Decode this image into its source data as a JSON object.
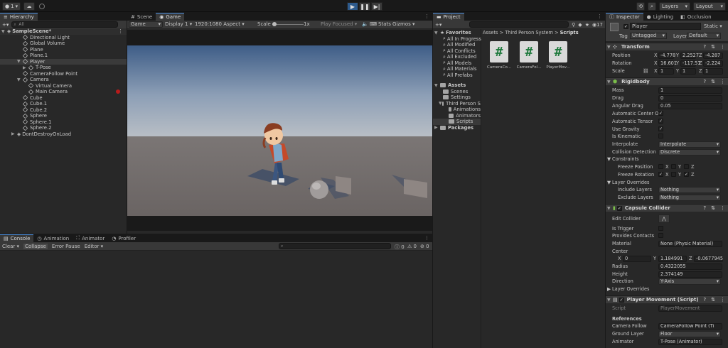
{
  "toolbar": {
    "account": "1",
    "layers": "Layers",
    "layout": "Layout"
  },
  "hierarchy": {
    "tab": "Hierarchy",
    "search_placeholder": "All",
    "scene": "SampleScene*",
    "items": [
      {
        "label": "Directional Light"
      },
      {
        "label": "Global Volume"
      },
      {
        "label": "Plane"
      },
      {
        "label": "Plane.1"
      },
      {
        "label": "Player"
      },
      {
        "label": "T-Pose"
      },
      {
        "label": "CameraFollow Point"
      },
      {
        "label": "Camera"
      },
      {
        "label": "Virtual Camera"
      },
      {
        "label": "Main Camera"
      },
      {
        "label": "Cube"
      },
      {
        "label": "Cube.1"
      },
      {
        "label": "Cube.2"
      },
      {
        "label": "Sphere"
      },
      {
        "label": "Sphere.1"
      },
      {
        "label": "Sphere.2"
      }
    ],
    "dontdestroy": "DontDestroyOnLoad"
  },
  "game": {
    "tabs": [
      "Scene",
      "Game"
    ],
    "mode": "Game",
    "display": "Display 1",
    "aspect": "1920:1080 Aspect",
    "scale_label": "Scale",
    "scale_value": "1x",
    "play_focused": "Play Focused",
    "stats": "Stats",
    "gizmos": "Gizmos"
  },
  "console": {
    "tabs": [
      "Console",
      "Animation",
      "Animator",
      "Profiler"
    ],
    "clear": "Clear",
    "collapse": "Collapse",
    "error_pause": "Error Pause",
    "editor": "Editor",
    "counts": [
      "0",
      "0",
      "0"
    ]
  },
  "project": {
    "tab": "Project",
    "breadcrumb": [
      "Assets",
      "Third Person System",
      "Scripts"
    ],
    "favorites_header": "Favorites",
    "favorites": [
      "All In Progress",
      "All Modified",
      "All Conflicts",
      "All Excluded",
      "All Models",
      "All Materials",
      "All Prefabs"
    ],
    "assets_header": "Assets",
    "assets": [
      "Scenes",
      "Settings",
      "Third Person S",
      "Animations",
      "Animators",
      "Scripts"
    ],
    "packages": "Packages",
    "files": [
      "CameraCo...",
      "CameraFol...",
      "PlayerMov..."
    ],
    "hidden_count": "17"
  },
  "inspector": {
    "tabs": [
      "Inspector",
      "Lighting",
      "Occlusion"
    ],
    "object_name": "Player",
    "static": "Static",
    "tag_label": "Tag",
    "tag_value": "Untagged",
    "layer_label": "Layer",
    "layer_value": "Default",
    "transform": {
      "title": "Transform",
      "position_label": "Position",
      "position": [
        "-4.778",
        "2.2527",
        "-4.287"
      ],
      "rotation_label": "Rotation",
      "rotation": [
        "16.601",
        "-117.51",
        "-2.224"
      ],
      "scale_label": "Scale",
      "scale": [
        "1",
        "1",
        "1"
      ]
    },
    "rigidbody": {
      "title": "Rigidbody",
      "mass_label": "Mass",
      "mass": "1",
      "drag_label": "Drag",
      "drag": "0",
      "angular_drag_label": "Angular Drag",
      "angular_drag": "0.05",
      "auto_com_label": "Automatic Center Of",
      "auto_tensor_label": "Automatic Tensor",
      "use_gravity_label": "Use Gravity",
      "is_kinematic_label": "Is Kinematic",
      "interpolate_label": "Interpolate",
      "interpolate": "Interpolate",
      "collision_label": "Collision Detection",
      "collision": "Discrete",
      "constraints_label": "Constraints",
      "freeze_pos_label": "Freeze Position",
      "freeze_rot_label": "Freeze Rotation",
      "layer_overrides_label": "Layer Overrides",
      "include_layers_label": "Include Layers",
      "include_layers": "Nothing",
      "exclude_layers_label": "Exclude Layers",
      "exclude_layers": "Nothing"
    },
    "capsule": {
      "title": "Capsule Collider",
      "edit_collider_label": "Edit Collider",
      "is_trigger_label": "Is Trigger",
      "provides_contacts_label": "Provides Contacts",
      "material_label": "Material",
      "material": "None (Physic Material)",
      "center_label": "Center",
      "center": [
        "0",
        "1.184991",
        "-0.0677945"
      ],
      "radius_label": "Radius",
      "radius": "0.4322055",
      "height_label": "Height",
      "height": "2.374149",
      "direction_label": "Direction",
      "direction": "Y-Axis",
      "layer_overrides_label": "Layer Overrides"
    },
    "player_movement": {
      "title": "Player Movement (Script)",
      "script_label": "Script",
      "script": "PlayerMovement",
      "references_label": "References",
      "camera_follow_label": "Camera Follow",
      "camera_follow": "CameraFollow Point (Ti",
      "ground_layer_label": "Ground Layer",
      "ground_layer": "Floor",
      "animator_label": "Animator",
      "animator": "T-Pose (Animator)"
    }
  },
  "colors": {
    "sky_top": "#3d5c85",
    "sky_bottom": "#b5bcc4",
    "ground": "#706a67",
    "accent": "#4a90e2"
  }
}
